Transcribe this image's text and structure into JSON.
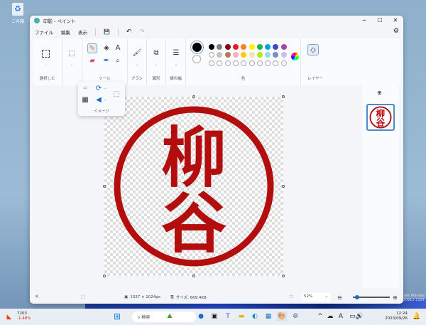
{
  "desktop": {
    "recycle_bin_label": "ごみ箱",
    "watermark_line1": "der Preview",
    "watermark_line2": "評価版です。Build 25951.zn_prerelease.230915-1324"
  },
  "window": {
    "title": "印影 - ペイント",
    "minimize": "─",
    "maximize": "☐",
    "close": "✕"
  },
  "menu": {
    "file": "ファイル",
    "edit": "編集",
    "view": "表示",
    "save": "💾",
    "undo": "↶",
    "redo": "↷",
    "settings": "⚙"
  },
  "ribbon": {
    "groups": {
      "selection": "選択した",
      "image": "イメージ",
      "tools": "ツール",
      "brushes": "ブラシ",
      "shapes": "図形",
      "size": "線の幅",
      "colors": "色",
      "layers": "レイヤー"
    },
    "text_tool": "A"
  },
  "colors": {
    "primary": "#000000",
    "secondary": "#ffffff",
    "row1": [
      "#000000",
      "#7f7f7f",
      "#880015",
      "#ed1c24",
      "#ff7f27",
      "#fff200",
      "#22b14c",
      "#00a2e8",
      "#3f48cc",
      "#a349a4"
    ],
    "row2": [
      "#ffffff",
      "#c3c3c3",
      "#b97a57",
      "#ffaec9",
      "#ffc90e",
      "#efe4b0",
      "#b5e61d",
      "#99d9ea",
      "#7092be",
      "#c8bfe7"
    ]
  },
  "stamp": {
    "chars": [
      "柳",
      "谷"
    ],
    "color": "#b30d0d"
  },
  "status": {
    "dimensions": "1037 × 1024px",
    "file_size": "サイズ: 669.4KB",
    "zoom": "52%",
    "zoom_fraction": 0.12
  },
  "taskbar": {
    "search_placeholder": "検索",
    "time": "12:24",
    "date": "2023/09/26",
    "stock_name": "7203",
    "stock_change": "-1.48%"
  }
}
